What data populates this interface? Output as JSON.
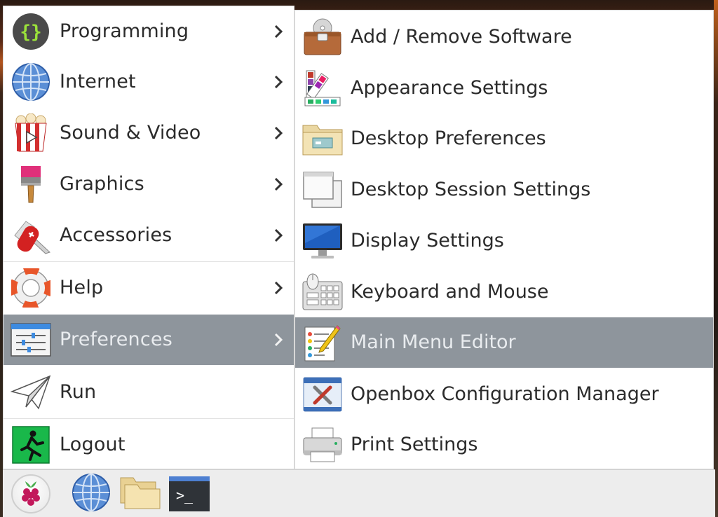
{
  "main_menu": {
    "items": [
      {
        "label": "Programming",
        "icon": "code-braces-icon"
      },
      {
        "label": "Internet",
        "icon": "globe-icon"
      },
      {
        "label": "Sound & Video",
        "icon": "popcorn-video-icon"
      },
      {
        "label": "Graphics",
        "icon": "paintbrush-icon"
      },
      {
        "label": "Accessories",
        "icon": "swiss-knife-icon"
      },
      {
        "label": "Help",
        "icon": "lifebuoy-icon"
      },
      {
        "label": "Preferences",
        "icon": "sliders-icon",
        "active": true
      },
      {
        "label": "Run",
        "icon": "paper-plane-icon"
      },
      {
        "label": "Logout",
        "icon": "exit-running-icon"
      }
    ]
  },
  "sub_menu": {
    "items": [
      {
        "label": "Add / Remove Software",
        "icon": "software-box-icon"
      },
      {
        "label": "Appearance Settings",
        "icon": "color-swatch-icon"
      },
      {
        "label": "Desktop Preferences",
        "icon": "folder-desktop-icon"
      },
      {
        "label": "Desktop Session Settings",
        "icon": "windows-stack-icon"
      },
      {
        "label": "Display Settings",
        "icon": "monitor-icon"
      },
      {
        "label": "Keyboard and Mouse",
        "icon": "keyboard-mouse-icon"
      },
      {
        "label": "Main Menu Editor",
        "icon": "menu-editor-icon",
        "active": true
      },
      {
        "label": "Openbox Configuration Manager",
        "icon": "openbox-tools-icon"
      },
      {
        "label": "Print Settings",
        "icon": "printer-icon"
      }
    ]
  },
  "taskbar": {
    "items": [
      {
        "name": "raspberry-menu-button",
        "icon": "raspberry-icon"
      },
      {
        "name": "browser-button",
        "icon": "globe-icon"
      },
      {
        "name": "file-manager-button",
        "icon": "folder-icon"
      },
      {
        "name": "terminal-button",
        "icon": "terminal-icon",
        "text": ">_"
      }
    ]
  },
  "colors": {
    "highlight": "#8e959c",
    "menu_bg": "#ffffff",
    "text": "#2b2b2b",
    "taskbar_bg": "#ededed"
  }
}
